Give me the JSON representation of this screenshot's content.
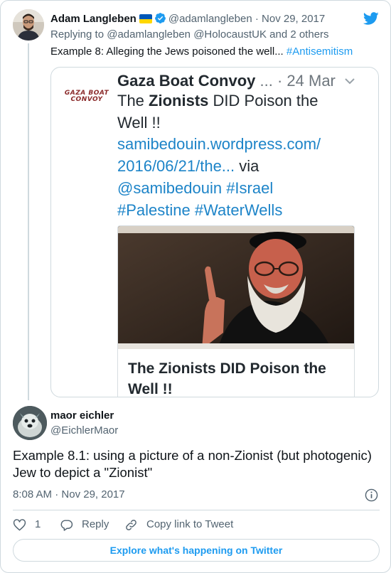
{
  "parent_tweet": {
    "author_name": "Adam Langleben",
    "author_handle": "@adamlangleben",
    "separator": "·",
    "date": "Nov 29, 2017",
    "replying_prefix": "Replying to",
    "replying_mentions": "@adamlangleben @HolocaustUK",
    "replying_suffix": "and 2 others",
    "text": "Example 8: Alleging the Jews poisoned the well...",
    "hashtag": "#Antisemitism",
    "embedded_image": {
      "logo_line1": "GAZA BOAT",
      "logo_line2": "CONVOY",
      "account_name": "Gaza Boat Convoy",
      "ellipsis": "...",
      "meta": "· 24 Mar",
      "line1_pre": "The",
      "line1_bold": "Zionists",
      "line1_post": "DID Poison the",
      "line2": "Well !!",
      "line3": "samibedouin.wordpress.com/",
      "line4_link": "2016/06/21/the...",
      "line4_post": "via",
      "line5": "@samibedouin #Israel",
      "line6": "#Palestine #WaterWells",
      "article_title": "The Zionists DID Poison the Well !!"
    }
  },
  "main_tweet": {
    "author_name": "maor eichler",
    "author_handle": "@EichlerMaor",
    "text": "Example 8.1: using a picture of a non-Zionist (but photogenic) Jew to depict a \"Zionist\"",
    "time": "8:08 AM",
    "separator": "·",
    "date": "Nov 29, 2017",
    "like_count": "1",
    "reply_label": "Reply",
    "copy_link_label": "Copy link to Tweet"
  },
  "footer": {
    "explore_label": "Explore what's happening on Twitter"
  },
  "colors": {
    "accent": "#1d9bf0",
    "text": "#0f1419",
    "muted": "#536471",
    "border": "#cfd9de",
    "flag_top": "#0057b7",
    "flag_bottom": "#ffd700"
  },
  "icons": [
    "twitter-bird-icon",
    "verified-badge-icon",
    "ukraine-flag-icon",
    "chevron-down-icon",
    "info-icon",
    "heart-icon",
    "reply-bubble-icon",
    "link-icon"
  ]
}
